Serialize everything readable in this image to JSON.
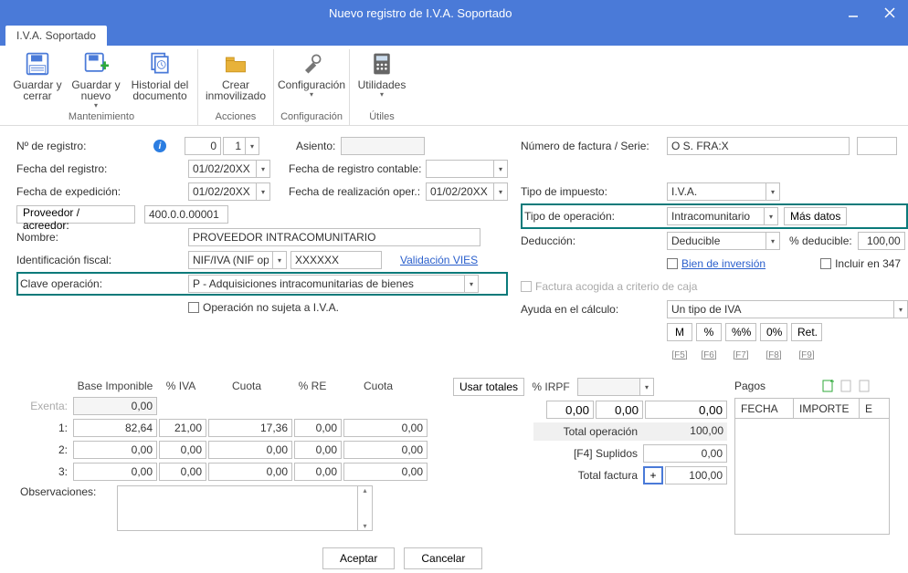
{
  "window": {
    "title": "Nuevo registro de I.V.A. Soportado"
  },
  "ribbon": {
    "tab": "I.V.A. Soportado",
    "groups": {
      "mantenimiento": {
        "label": "Mantenimiento",
        "save_close": "Guardar y cerrar",
        "save_new": "Guardar y nuevo",
        "doc_history": "Historial del documento"
      },
      "acciones": {
        "label": "Acciones",
        "crear_inmov": "Crear inmovilizado"
      },
      "config": {
        "label": "Configuración",
        "config": "Configuración"
      },
      "utiles": {
        "label": "Útiles",
        "utilidades": "Utilidades"
      }
    }
  },
  "left": {
    "n_registro_lbl": "Nº de registro:",
    "n_registro_a": "0",
    "n_registro_b": "1",
    "asiento_lbl": "Asiento:",
    "asiento_val": "",
    "fecha_registro_lbl": "Fecha del registro:",
    "fecha_registro": "01/02/20XX",
    "fecha_reg_cont_lbl": "Fecha de registro contable:",
    "fecha_reg_cont": "",
    "fecha_exped_lbl": "Fecha de expedición:",
    "fecha_exped": "01/02/20XX",
    "fecha_realiz_lbl": "Fecha de realización oper.:",
    "fecha_realiz": "01/02/20XX",
    "proveedor_btn": "Proveedor / acreedor:",
    "proveedor_val": "400.0.0.00001",
    "nombre_lbl": "Nombre:",
    "nombre_val": "PROVEEDOR INTRACOMUNITARIO",
    "id_fiscal_lbl": "Identificación fiscal:",
    "id_fiscal_tipo": "NIF/IVA (NIF oper",
    "id_fiscal_num": "XXXXXX",
    "valid_link": "Validación VIES",
    "clave_op_lbl": "Clave operación:",
    "clave_op_val": "P - Adquisiciones intracomunitarias de bienes",
    "no_sujeta_chk": "Operación no sujeta a I.V.A."
  },
  "right": {
    "num_fact_lbl": "Número de factura / Serie:",
    "num_fact_val": "O S. FRA:X",
    "tipo_imp_lbl": "Tipo de impuesto:",
    "tipo_imp_val": "I.V.A.",
    "tipo_op_lbl": "Tipo de operación:",
    "tipo_op_val": "Intracomunitario",
    "mas_datos_btn": "Más datos",
    "deduccion_lbl": "Deducción:",
    "deduccion_val": "Deducible",
    "pct_ded_lbl": "% deducible:",
    "pct_ded_val": "100,00",
    "bien_inv_chk": "Bien de inversión",
    "incl_347_chk": "Incluir en 347",
    "crit_caja_chk": "Factura acogida a criterio de caja",
    "ayuda_lbl": "Ayuda en el cálculo:",
    "ayuda_val": "Un tipo de IVA",
    "btn_m": "M",
    "btn_pct": "%",
    "btn_pctpct": "%%",
    "btn_0": "0%",
    "btn_ret": "Ret.",
    "sc_f5": "[F5]",
    "sc_f6": "[F6]",
    "sc_f7": "[F7]",
    "sc_f8": "[F8]",
    "sc_f9": "[F9]"
  },
  "tax": {
    "h_base": "Base Imponible",
    "h_iva": "% IVA",
    "h_cuota": "Cuota",
    "h_re": "% RE",
    "h_cuota2": "Cuota",
    "usar_totales_btn": "Usar totales",
    "h_irpf": "% IRPF",
    "r_exenta_lbl": "Exenta:",
    "r_exenta_base": "0,00",
    "r1_lbl": "1:",
    "r1_base": "82,64",
    "r1_iva": "21,00",
    "r1_cuota": "17,36",
    "r1_re": "0,00",
    "r1_cuota2": "0,00",
    "r2_lbl": "2:",
    "r2_base": "0,00",
    "r2_iva": "0,00",
    "r2_cuota": "0,00",
    "r2_re": "0,00",
    "r2_cuota2": "0,00",
    "r3_lbl": "3:",
    "r3_base": "0,00",
    "r3_iva": "0,00",
    "r3_cuota": "0,00",
    "r3_re": "0,00",
    "r3_cuota2": "0,00",
    "obs_lbl": "Observaciones:",
    "irpf_a": "0,00",
    "irpf_b": "0,00",
    "irpf_c": "0,00",
    "tot_op_lbl": "Total operación",
    "tot_op_val": "100,00",
    "suplidos_lbl": "[F4] Suplidos",
    "suplidos_val": "0,00",
    "tot_fact_lbl": "Total factura",
    "tot_fact_btn": "+",
    "tot_fact_val": "100,00"
  },
  "pagos": {
    "title": "Pagos",
    "col_fecha": "FECHA",
    "col_importe": "IMPORTE",
    "col_e": "E"
  },
  "footer": {
    "aceptar": "Aceptar",
    "cancelar": "Cancelar"
  }
}
